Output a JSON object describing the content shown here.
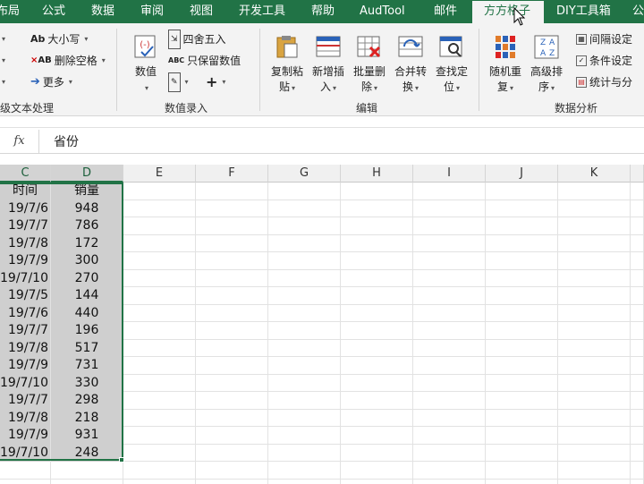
{
  "ribbon": {
    "tabs": [
      {
        "label": "布局",
        "id": "layout"
      },
      {
        "label": "公式",
        "id": "formulas"
      },
      {
        "label": "数据",
        "id": "data"
      },
      {
        "label": "审阅",
        "id": "review"
      },
      {
        "label": "视图",
        "id": "view"
      },
      {
        "label": "开发工具",
        "id": "developer"
      },
      {
        "label": "帮助",
        "id": "help"
      },
      {
        "label": "AudTool",
        "id": "audtool"
      },
      {
        "label": "邮件",
        "id": "mail"
      },
      {
        "label": "方方格子",
        "id": "ffcell"
      },
      {
        "label": "DIY工具箱",
        "id": "diy"
      },
      {
        "label": "公",
        "id": "more"
      }
    ],
    "active_tab": "方方格子",
    "groups": {
      "text": {
        "label": "级文本处理",
        "case_btn": "大小写",
        "remove_space_btn": "删除空格",
        "more_btn": "更多"
      },
      "numeric": {
        "label": "数值录入",
        "value_btn": "数值",
        "round_btn": "四舍五入",
        "keep_value_btn": "只保留数值",
        "plus_symbol": "+"
      },
      "edit": {
        "label": "编辑",
        "copy_paste": [
          "复制粘",
          "贴"
        ],
        "new_insert": [
          "新增插",
          "入"
        ],
        "batch_delete": [
          "批量删",
          "除"
        ],
        "merge_convert": [
          "合并转",
          "换"
        ],
        "find_locate": [
          "查找定",
          "位"
        ]
      },
      "analysis": {
        "label": "数据分析",
        "random_repeat": [
          "随机重",
          "复"
        ],
        "advanced_sort": [
          "高级排",
          "序"
        ],
        "interval_setting": "间隔设定",
        "condition_setting": "条件设定",
        "stats_analysis": "统计与分"
      }
    },
    "accent": "#217346"
  },
  "formula_bar": {
    "fx_label": "fx",
    "content": "省份"
  },
  "sheet": {
    "columns": [
      "C",
      "D",
      "E",
      "F",
      "G",
      "H",
      "I",
      "J",
      "K"
    ],
    "selected_columns": [
      "C",
      "D"
    ],
    "headers": {
      "c": "时间",
      "d": "销量"
    },
    "rows": [
      {
        "c": "19/7/6",
        "d": "948"
      },
      {
        "c": "19/7/7",
        "d": "786"
      },
      {
        "c": "19/7/8",
        "d": "172"
      },
      {
        "c": "19/7/9",
        "d": "300"
      },
      {
        "c": "19/7/10",
        "d": "270"
      },
      {
        "c": "19/7/5",
        "d": "144"
      },
      {
        "c": "19/7/6",
        "d": "440"
      },
      {
        "c": "19/7/7",
        "d": "196"
      },
      {
        "c": "19/7/8",
        "d": "517"
      },
      {
        "c": "19/7/9",
        "d": "731"
      },
      {
        "c": "19/7/10",
        "d": "330"
      },
      {
        "c": "19/7/7",
        "d": "298"
      },
      {
        "c": "19/7/8",
        "d": "218"
      },
      {
        "c": "19/7/9",
        "d": "931"
      },
      {
        "c": "19/7/10",
        "d": "248"
      }
    ]
  }
}
